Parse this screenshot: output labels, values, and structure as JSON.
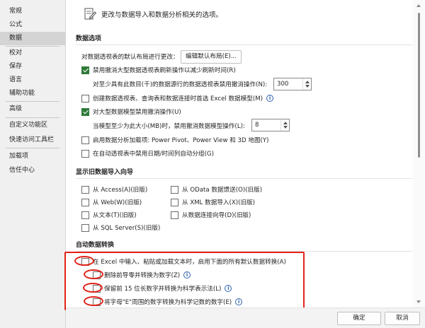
{
  "nav": {
    "items": [
      "常规",
      "公式",
      "数据",
      "校对",
      "保存",
      "语言",
      "辅助功能",
      "高级",
      "自定义功能区",
      "快速访问工具栏",
      "加载项",
      "信任中心"
    ],
    "selected": "数据"
  },
  "header": {
    "text": "更改与数据导入和数据分析相关的选项。"
  },
  "sections": {
    "data_options": "数据选项",
    "legacy": "显示旧数据导入向导",
    "auto": "自动数据转换"
  },
  "data_options": {
    "default_layout_label": "对数据透视表的默认布局进行更改：",
    "default_layout_button": "编辑默认布局(E)...",
    "disable_undo_large_pt": "禁用撤消大型数据透视表刷新操作以减少刷新时间(R)",
    "disable_undo_rows_label": "对至少具有此数目(千)的数据源行的数据透视表禁用撤消操作(N):",
    "disable_undo_rows_value": "300",
    "prefer_excel_model": "创建数据透视表、查询表和数据连接时首选 Excel 数据模型(M)",
    "disable_undo_model": "对大型数据模型禁用撤消操作(U)",
    "disable_undo_model_label": "当模型至少为此大小(MB)时，禁用撤消数据模型操作(L):",
    "disable_undo_model_value": "8",
    "enable_addins": "启用数据分析加载项: Power Pivot、Power View 和 3D 地图(Y)",
    "disable_auto_group": "在自动透视表中禁用日期/时间列自动分组(G)"
  },
  "legacy": {
    "access": "从 Access(A)(旧版)",
    "odata": "从 OData 数据馈送(O)(旧版)",
    "web": "从 Web(W)(旧版)",
    "xml": "从 XML 数据导入(X)(旧版)",
    "text": "从文本(T)(旧版)",
    "conn": "从数据连接向导(D)(旧版)",
    "sql": "从 SQL Server(S)(旧版)"
  },
  "auto": {
    "main": "在 Excel 中输入、粘贴或加载文本时，启用下面的所有默认数据转换(A)",
    "leading_zeros": "删除前导零并转换为数字(Z)",
    "keep_15_digits": "保留前 15 位长数字并转换为科学表示法(L)",
    "scientific_e": "将字母\"E\"周围的数字转换为科学记数的数字(E)"
  },
  "footer": {
    "ok": "确定",
    "cancel": "取消"
  },
  "colors": {
    "checkbox_checked": "#2f7a3a",
    "annotation_red": "#e2231a",
    "nav_selected": "#d4d4d4"
  },
  "checked": {
    "disable_undo_large_pt": true,
    "prefer_excel_model": false,
    "disable_undo_model": true,
    "enable_addins": false,
    "disable_auto_group": false
  }
}
